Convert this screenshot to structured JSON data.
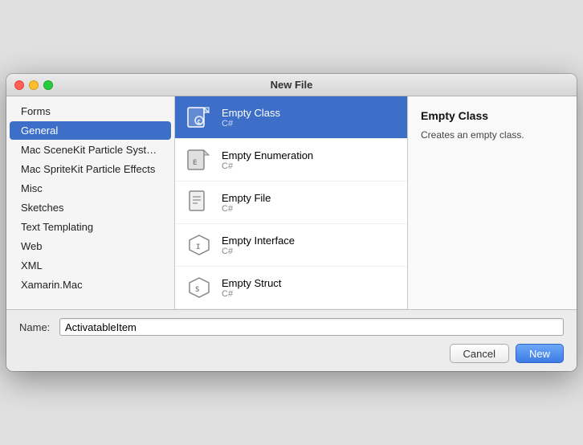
{
  "window": {
    "title": "New File"
  },
  "sidebar": {
    "items": [
      {
        "id": "forms",
        "label": "Forms"
      },
      {
        "id": "general",
        "label": "General",
        "selected": true
      },
      {
        "id": "mac-scenekit",
        "label": "Mac SceneKit Particle System"
      },
      {
        "id": "mac-spritekit",
        "label": "Mac SpriteKit Particle Effects"
      },
      {
        "id": "misc",
        "label": "Misc"
      },
      {
        "id": "sketches",
        "label": "Sketches"
      },
      {
        "id": "text-templating",
        "label": "Text Templating"
      },
      {
        "id": "web",
        "label": "Web"
      },
      {
        "id": "xml",
        "label": "XML"
      },
      {
        "id": "xamarin-mac",
        "label": "Xamarin.Mac"
      }
    ]
  },
  "templates": {
    "items": [
      {
        "id": "empty-class",
        "label": "Empty Class",
        "subtitle": "C#",
        "selected": true
      },
      {
        "id": "empty-enumeration",
        "label": "Empty Enumeration",
        "subtitle": "C#"
      },
      {
        "id": "empty-file",
        "label": "Empty File",
        "subtitle": "C#"
      },
      {
        "id": "empty-interface",
        "label": "Empty Interface",
        "subtitle": "C#"
      },
      {
        "id": "empty-struct",
        "label": "Empty Struct",
        "subtitle": "C#"
      }
    ]
  },
  "description": {
    "title": "Empty Class",
    "text": "Creates an empty class."
  },
  "name_field": {
    "label": "Name:",
    "value": "ActivatableItem",
    "placeholder": ""
  },
  "buttons": {
    "cancel": "Cancel",
    "new": "New"
  },
  "icons": {
    "empty_class": "C",
    "empty_enumeration": "E",
    "empty_file": "F",
    "empty_interface": "I",
    "empty_struct": "S"
  }
}
